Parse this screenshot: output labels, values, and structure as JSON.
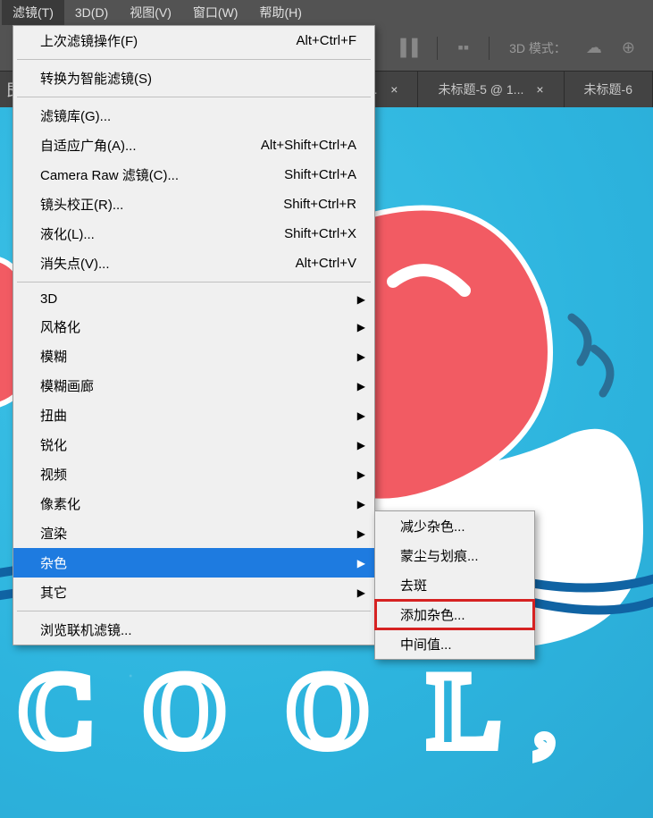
{
  "menubar": {
    "items": [
      "滤镜(T)",
      "3D(D)",
      "视图(V)",
      "窗口(W)",
      "帮助(H)"
    ]
  },
  "toolbar": {
    "mode_label": "3D 模式："
  },
  "doctabs": {
    "left_partial": "艮",
    "tab1": "未标题-5 @ 1...",
    "tab2": "未标题-6"
  },
  "menu": {
    "last": {
      "label": "上次滤镜操作(F)",
      "shortcut": "Alt+Ctrl+F"
    },
    "convert": {
      "label": "转换为智能滤镜(S)"
    },
    "gallery": {
      "label": "滤镜库(G)..."
    },
    "adaptive": {
      "label": "自适应广角(A)...",
      "shortcut": "Alt+Shift+Ctrl+A"
    },
    "cameraraw": {
      "label": "Camera Raw 滤镜(C)...",
      "shortcut": "Shift+Ctrl+A"
    },
    "lens": {
      "label": "镜头校正(R)...",
      "shortcut": "Shift+Ctrl+R"
    },
    "liquify": {
      "label": "液化(L)...",
      "shortcut": "Shift+Ctrl+X"
    },
    "vanish": {
      "label": "消失点(V)...",
      "shortcut": "Alt+Ctrl+V"
    },
    "threeD": {
      "label": "3D"
    },
    "stylize": {
      "label": "风格化"
    },
    "blur": {
      "label": "模糊"
    },
    "blurgallery": {
      "label": "模糊画廊"
    },
    "distort": {
      "label": "扭曲"
    },
    "sharpen": {
      "label": "锐化"
    },
    "video": {
      "label": "视频"
    },
    "pixelate": {
      "label": "像素化"
    },
    "render": {
      "label": "渲染"
    },
    "noise": {
      "label": "杂色"
    },
    "other": {
      "label": "其它"
    },
    "browse": {
      "label": "浏览联机滤镜..."
    }
  },
  "submenu": {
    "reduce": "减少杂色...",
    "dust": "蒙尘与划痕...",
    "despeckle": "去斑",
    "addnoise": "添加杂色...",
    "median": "中间值..."
  }
}
